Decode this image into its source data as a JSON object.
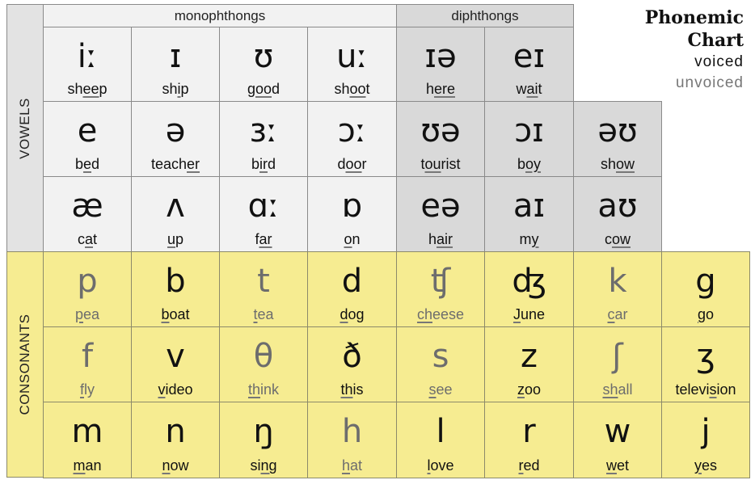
{
  "title": {
    "line1": "Phonemic",
    "line2": "Chart"
  },
  "legend": {
    "voiced": "voiced",
    "unvoiced": "unvoiced"
  },
  "colors": {
    "monophthong_bg": "#f2f2f2",
    "diphthong_bg": "#d9d9d9",
    "consonant_bg": "#f6ec91",
    "voiced_text": "#111111",
    "unvoiced_text": "#6d6d6d"
  },
  "sections": {
    "vowels": "VOWELS",
    "consonants": "CONSONANTS"
  },
  "headers": {
    "monophthongs": "monophthongs",
    "diphthongs": "diphthongs"
  },
  "vowels": [
    [
      {
        "symbol": "iː",
        "pre": "sh",
        "mark": "ee",
        "post": "p",
        "type": "mono"
      },
      {
        "symbol": "ɪ",
        "pre": "sh",
        "mark": "i",
        "post": "p",
        "type": "mono"
      },
      {
        "symbol": "ʊ",
        "pre": "g",
        "mark": "oo",
        "post": "d",
        "type": "mono"
      },
      {
        "symbol": "uː",
        "pre": "sh",
        "mark": "oo",
        "post": "t",
        "type": "mono"
      },
      {
        "symbol": "ɪə",
        "pre": "h",
        "mark": "ere",
        "post": "",
        "type": "diph"
      },
      {
        "symbol": "eɪ",
        "pre": "w",
        "mark": "ai",
        "post": "t",
        "type": "diph"
      }
    ],
    [
      {
        "symbol": "e",
        "pre": "b",
        "mark": "e",
        "post": "d",
        "type": "mono"
      },
      {
        "symbol": "ə",
        "pre": "teach",
        "mark": "er",
        "post": "",
        "type": "mono"
      },
      {
        "symbol": "ɜː",
        "pre": "b",
        "mark": "ir",
        "post": "d",
        "type": "mono"
      },
      {
        "symbol": "ɔː",
        "pre": "d",
        "mark": "oo",
        "post": "r",
        "type": "mono"
      },
      {
        "symbol": "ʊə",
        "pre": "t",
        "mark": "ou",
        "post": "rist",
        "type": "diph"
      },
      {
        "symbol": "ɔɪ",
        "pre": "b",
        "mark": "oy",
        "post": "",
        "type": "diph"
      },
      {
        "symbol": "əʊ",
        "pre": "sh",
        "mark": "ow",
        "post": "",
        "type": "diph"
      }
    ],
    [
      {
        "symbol": "æ",
        "pre": "c",
        "mark": "a",
        "post": "t",
        "type": "mono"
      },
      {
        "symbol": "ʌ",
        "pre": "",
        "mark": "u",
        "post": "p",
        "type": "mono"
      },
      {
        "symbol": "ɑː",
        "pre": "f",
        "mark": "ar",
        "post": "",
        "type": "mono"
      },
      {
        "symbol": "ɒ",
        "pre": "",
        "mark": "o",
        "post": "n",
        "type": "mono"
      },
      {
        "symbol": "eə",
        "pre": "h",
        "mark": "air",
        "post": "",
        "type": "diph"
      },
      {
        "symbol": "aɪ",
        "pre": "m",
        "mark": "y",
        "post": "",
        "type": "diph"
      },
      {
        "symbol": "aʊ",
        "pre": "c",
        "mark": "ow",
        "post": "",
        "type": "diph"
      }
    ]
  ],
  "consonants": [
    [
      {
        "symbol": "p",
        "pre": "",
        "mark": "p",
        "post": "ea",
        "voiced": false
      },
      {
        "symbol": "b",
        "pre": "",
        "mark": "b",
        "post": "oat",
        "voiced": true
      },
      {
        "symbol": "t",
        "pre": "",
        "mark": "t",
        "post": "ea",
        "voiced": false
      },
      {
        "symbol": "d",
        "pre": "",
        "mark": "d",
        "post": "og",
        "voiced": true
      },
      {
        "symbol": "ʧ",
        "pre": "",
        "mark": "ch",
        "post": "eese",
        "voiced": false
      },
      {
        "symbol": "ʤ",
        "pre": "",
        "mark": "J",
        "post": "une",
        "voiced": true
      },
      {
        "symbol": "k",
        "pre": "",
        "mark": "c",
        "post": "ar",
        "voiced": false
      },
      {
        "symbol": "g",
        "pre": "",
        "mark": "g",
        "post": "o",
        "voiced": true
      }
    ],
    [
      {
        "symbol": "f",
        "pre": "",
        "mark": "f",
        "post": "ly",
        "voiced": false
      },
      {
        "symbol": "v",
        "pre": "",
        "mark": "v",
        "post": "ideo",
        "voiced": true
      },
      {
        "symbol": "θ",
        "pre": "",
        "mark": "th",
        "post": "ink",
        "voiced": false
      },
      {
        "symbol": "ð",
        "pre": "",
        "mark": "th",
        "post": "is",
        "voiced": true
      },
      {
        "symbol": "s",
        "pre": "",
        "mark": "s",
        "post": "ee",
        "voiced": false
      },
      {
        "symbol": "z",
        "pre": "",
        "mark": "z",
        "post": "oo",
        "voiced": true
      },
      {
        "symbol": "ʃ",
        "pre": "",
        "mark": "sh",
        "post": "all",
        "voiced": false
      },
      {
        "symbol": "ʒ",
        "pre": "televi",
        "mark": "s",
        "post": "ion",
        "voiced": true
      }
    ],
    [
      {
        "symbol": "m",
        "pre": "",
        "mark": "m",
        "post": "an",
        "voiced": true
      },
      {
        "symbol": "n",
        "pre": "",
        "mark": "n",
        "post": "ow",
        "voiced": true
      },
      {
        "symbol": "ŋ",
        "pre": "si",
        "mark": "ng",
        "post": "",
        "voiced": true
      },
      {
        "symbol": "h",
        "pre": "",
        "mark": "h",
        "post": "at",
        "voiced": false
      },
      {
        "symbol": "l",
        "pre": "",
        "mark": "l",
        "post": "ove",
        "voiced": true
      },
      {
        "symbol": "r",
        "pre": "",
        "mark": "r",
        "post": "ed",
        "voiced": true
      },
      {
        "symbol": "w",
        "pre": "",
        "mark": "w",
        "post": "et",
        "voiced": true
      },
      {
        "symbol": "j",
        "pre": "",
        "mark": "y",
        "post": "es",
        "voiced": true
      }
    ]
  ]
}
